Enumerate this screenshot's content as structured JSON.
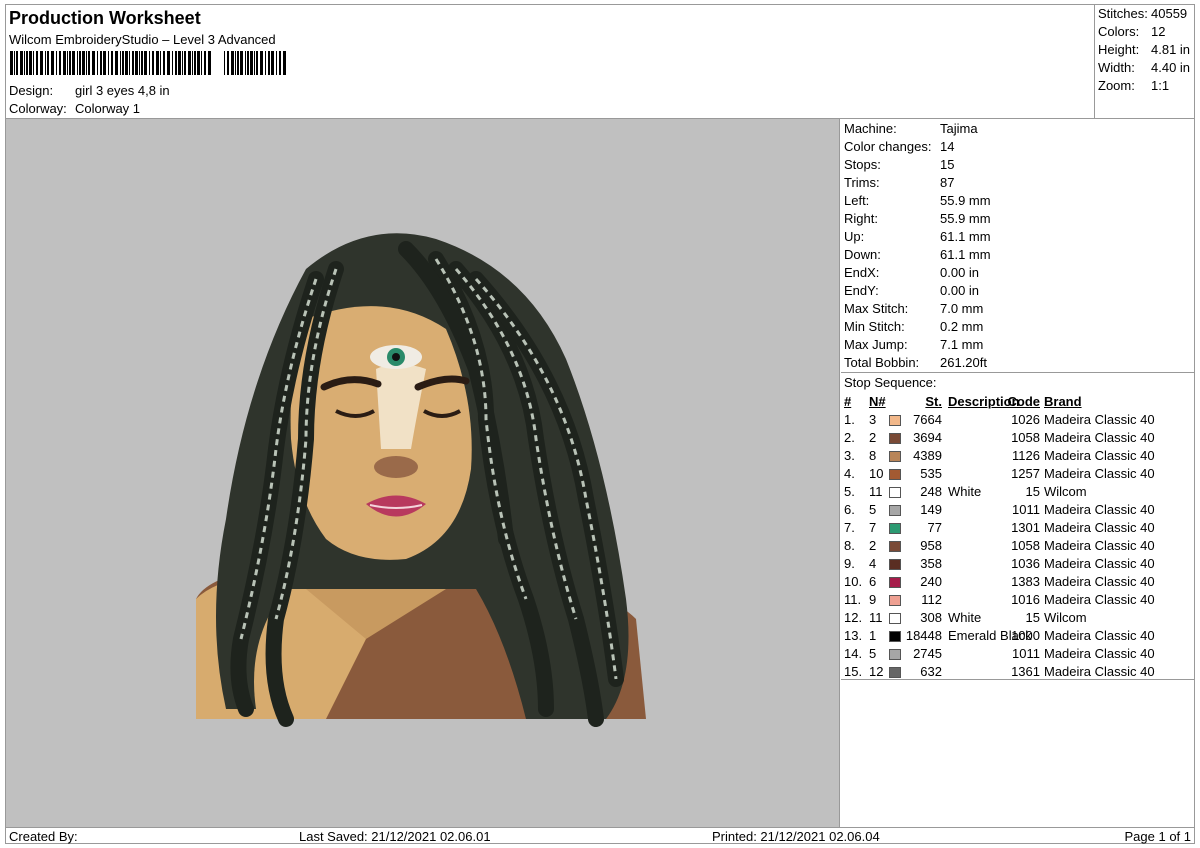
{
  "header": {
    "title": "Production Worksheet",
    "software": "Wilcom EmbroideryStudio – Level 3 Advanced",
    "design_label": "Design:",
    "design_value": "girl 3 eyes 4,8 in",
    "colorway_label": "Colorway:",
    "colorway_value": "Colorway 1"
  },
  "summary": [
    {
      "label": "Stitches:",
      "value": "40559"
    },
    {
      "label": "Colors:",
      "value": "12"
    },
    {
      "label": "Height:",
      "value": "4.81 in"
    },
    {
      "label": "Width:",
      "value": "4.40 in"
    },
    {
      "label": "Zoom:",
      "value": "1:1"
    }
  ],
  "machine_info": [
    {
      "label": "Machine:",
      "value": "Tajima"
    },
    {
      "label": "Color changes:",
      "value": "14"
    },
    {
      "label": "Stops:",
      "value": "15"
    },
    {
      "label": "Trims:",
      "value": "87"
    },
    {
      "label": "Left:",
      "value": "55.9 mm"
    },
    {
      "label": "Right:",
      "value": "55.9 mm"
    },
    {
      "label": "Up:",
      "value": "61.1 mm"
    },
    {
      "label": "Down:",
      "value": "61.1 mm"
    },
    {
      "label": "EndX:",
      "value": "0.00 in"
    },
    {
      "label": "EndY:",
      "value": "0.00 in"
    },
    {
      "label": "Max Stitch:",
      "value": "7.0 mm"
    },
    {
      "label": "Min Stitch:",
      "value": "0.2 mm"
    },
    {
      "label": "Max Jump:",
      "value": "7.1 mm"
    },
    {
      "label": "Total Bobbin:",
      "value": "261.20ft"
    }
  ],
  "stop_sequence": {
    "title": "Stop Sequence:",
    "headers": {
      "num": "#",
      "n": "N#",
      "st": "St.",
      "desc": "Description",
      "code": "Code",
      "brand": "Brand"
    },
    "rows": [
      {
        "num": "1.",
        "n": "3",
        "color": "#f2b88a",
        "st": "7664",
        "desc": "",
        "code": "1026",
        "brand": "Madeira Classic 40"
      },
      {
        "num": "2.",
        "n": "2",
        "color": "#7a4a36",
        "st": "3694",
        "desc": "",
        "code": "1058",
        "brand": "Madeira Classic 40"
      },
      {
        "num": "3.",
        "n": "8",
        "color": "#b98558",
        "st": "4389",
        "desc": "",
        "code": "1126",
        "brand": "Madeira Classic 40"
      },
      {
        "num": "4.",
        "n": "10",
        "color": "#a35a32",
        "st": "535",
        "desc": "",
        "code": "1257",
        "brand": "Madeira Classic 40"
      },
      {
        "num": "5.",
        "n": "11",
        "color": "#ffffff",
        "st": "248",
        "desc": "White",
        "code": "15",
        "brand": "Wilcom"
      },
      {
        "num": "6.",
        "n": "5",
        "color": "#a6a6a6",
        "st": "149",
        "desc": "",
        "code": "1011",
        "brand": "Madeira Classic 40"
      },
      {
        "num": "7.",
        "n": "7",
        "color": "#2c9a72",
        "st": "77",
        "desc": "",
        "code": "1301",
        "brand": "Madeira Classic 40"
      },
      {
        "num": "8.",
        "n": "2",
        "color": "#7a4a36",
        "st": "958",
        "desc": "",
        "code": "1058",
        "brand": "Madeira Classic 40"
      },
      {
        "num": "9.",
        "n": "4",
        "color": "#5a2e22",
        "st": "358",
        "desc": "",
        "code": "1036",
        "brand": "Madeira Classic 40"
      },
      {
        "num": "10.",
        "n": "6",
        "color": "#a61c4a",
        "st": "240",
        "desc": "",
        "code": "1383",
        "brand": "Madeira Classic 40"
      },
      {
        "num": "11.",
        "n": "9",
        "color": "#eea092",
        "st": "112",
        "desc": "",
        "code": "1016",
        "brand": "Madeira Classic 40"
      },
      {
        "num": "12.",
        "n": "11",
        "color": "#ffffff",
        "st": "308",
        "desc": "White",
        "code": "15",
        "brand": "Wilcom"
      },
      {
        "num": "13.",
        "n": "1",
        "color": "#000000",
        "st": "18448",
        "desc": "Emerald Black",
        "code": "1000",
        "brand": "Madeira Classic 40"
      },
      {
        "num": "14.",
        "n": "5",
        "color": "#a6a6a6",
        "st": "2745",
        "desc": "",
        "code": "1011",
        "brand": "Madeira Classic 40"
      },
      {
        "num": "15.",
        "n": "12",
        "color": "#666666",
        "st": "632",
        "desc": "",
        "code": "1361",
        "brand": "Madeira Classic 40"
      }
    ]
  },
  "footer": {
    "created_by": "Created By:",
    "last_saved": "Last Saved: 21/12/2021 02.06.01",
    "printed": "Printed: 21/12/2021 02.06.04",
    "page": "Page 1 of 1"
  },
  "preview": {
    "background": "#c0c0c0",
    "subject": "embroidery design preview (woman with three eyes and locs)"
  }
}
